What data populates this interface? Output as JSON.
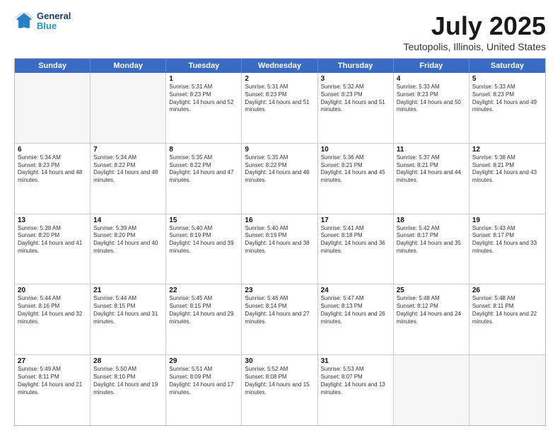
{
  "header": {
    "logo_line1": "General",
    "logo_line2": "Blue",
    "title": "July 2025",
    "subtitle": "Teutopolis, Illinois, United States"
  },
  "weekdays": [
    "Sunday",
    "Monday",
    "Tuesday",
    "Wednesday",
    "Thursday",
    "Friday",
    "Saturday"
  ],
  "weeks": [
    [
      {
        "day": "",
        "sunrise": "",
        "sunset": "",
        "daylight": "",
        "empty": true
      },
      {
        "day": "",
        "sunrise": "",
        "sunset": "",
        "daylight": "",
        "empty": true
      },
      {
        "day": "1",
        "sunrise": "Sunrise: 5:31 AM",
        "sunset": "Sunset: 8:23 PM",
        "daylight": "Daylight: 14 hours and 52 minutes."
      },
      {
        "day": "2",
        "sunrise": "Sunrise: 5:31 AM",
        "sunset": "Sunset: 8:23 PM",
        "daylight": "Daylight: 14 hours and 51 minutes."
      },
      {
        "day": "3",
        "sunrise": "Sunrise: 5:32 AM",
        "sunset": "Sunset: 8:23 PM",
        "daylight": "Daylight: 14 hours and 51 minutes."
      },
      {
        "day": "4",
        "sunrise": "Sunrise: 5:33 AM",
        "sunset": "Sunset: 8:23 PM",
        "daylight": "Daylight: 14 hours and 50 minutes."
      },
      {
        "day": "5",
        "sunrise": "Sunrise: 5:33 AM",
        "sunset": "Sunset: 8:23 PM",
        "daylight": "Daylight: 14 hours and 49 minutes."
      }
    ],
    [
      {
        "day": "6",
        "sunrise": "Sunrise: 5:34 AM",
        "sunset": "Sunset: 8:23 PM",
        "daylight": "Daylight: 14 hours and 48 minutes."
      },
      {
        "day": "7",
        "sunrise": "Sunrise: 5:34 AM",
        "sunset": "Sunset: 8:22 PM",
        "daylight": "Daylight: 14 hours and 48 minutes."
      },
      {
        "day": "8",
        "sunrise": "Sunrise: 5:35 AM",
        "sunset": "Sunset: 8:22 PM",
        "daylight": "Daylight: 14 hours and 47 minutes."
      },
      {
        "day": "9",
        "sunrise": "Sunrise: 5:35 AM",
        "sunset": "Sunset: 8:22 PM",
        "daylight": "Daylight: 14 hours and 46 minutes."
      },
      {
        "day": "10",
        "sunrise": "Sunrise: 5:36 AM",
        "sunset": "Sunset: 8:21 PM",
        "daylight": "Daylight: 14 hours and 45 minutes."
      },
      {
        "day": "11",
        "sunrise": "Sunrise: 5:37 AM",
        "sunset": "Sunset: 8:21 PM",
        "daylight": "Daylight: 14 hours and 44 minutes."
      },
      {
        "day": "12",
        "sunrise": "Sunrise: 5:38 AM",
        "sunset": "Sunset: 8:21 PM",
        "daylight": "Daylight: 14 hours and 43 minutes."
      }
    ],
    [
      {
        "day": "13",
        "sunrise": "Sunrise: 5:38 AM",
        "sunset": "Sunset: 8:20 PM",
        "daylight": "Daylight: 14 hours and 41 minutes."
      },
      {
        "day": "14",
        "sunrise": "Sunrise: 5:39 AM",
        "sunset": "Sunset: 8:20 PM",
        "daylight": "Daylight: 14 hours and 40 minutes."
      },
      {
        "day": "15",
        "sunrise": "Sunrise: 5:40 AM",
        "sunset": "Sunset: 8:19 PM",
        "daylight": "Daylight: 14 hours and 39 minutes."
      },
      {
        "day": "16",
        "sunrise": "Sunrise: 5:40 AM",
        "sunset": "Sunset: 8:19 PM",
        "daylight": "Daylight: 14 hours and 38 minutes."
      },
      {
        "day": "17",
        "sunrise": "Sunrise: 5:41 AM",
        "sunset": "Sunset: 8:18 PM",
        "daylight": "Daylight: 14 hours and 36 minutes."
      },
      {
        "day": "18",
        "sunrise": "Sunrise: 5:42 AM",
        "sunset": "Sunset: 8:17 PM",
        "daylight": "Daylight: 14 hours and 35 minutes."
      },
      {
        "day": "19",
        "sunrise": "Sunrise: 5:43 AM",
        "sunset": "Sunset: 8:17 PM",
        "daylight": "Daylight: 14 hours and 33 minutes."
      }
    ],
    [
      {
        "day": "20",
        "sunrise": "Sunrise: 5:44 AM",
        "sunset": "Sunset: 8:16 PM",
        "daylight": "Daylight: 14 hours and 32 minutes."
      },
      {
        "day": "21",
        "sunrise": "Sunrise: 5:44 AM",
        "sunset": "Sunset: 8:15 PM",
        "daylight": "Daylight: 14 hours and 31 minutes."
      },
      {
        "day": "22",
        "sunrise": "Sunrise: 5:45 AM",
        "sunset": "Sunset: 8:15 PM",
        "daylight": "Daylight: 14 hours and 29 minutes."
      },
      {
        "day": "23",
        "sunrise": "Sunrise: 5:46 AM",
        "sunset": "Sunset: 8:14 PM",
        "daylight": "Daylight: 14 hours and 27 minutes."
      },
      {
        "day": "24",
        "sunrise": "Sunrise: 5:47 AM",
        "sunset": "Sunset: 8:13 PM",
        "daylight": "Daylight: 14 hours and 26 minutes."
      },
      {
        "day": "25",
        "sunrise": "Sunrise: 5:48 AM",
        "sunset": "Sunset: 8:12 PM",
        "daylight": "Daylight: 14 hours and 24 minutes."
      },
      {
        "day": "26",
        "sunrise": "Sunrise: 5:48 AM",
        "sunset": "Sunset: 8:11 PM",
        "daylight": "Daylight: 14 hours and 22 minutes."
      }
    ],
    [
      {
        "day": "27",
        "sunrise": "Sunrise: 5:49 AM",
        "sunset": "Sunset: 8:11 PM",
        "daylight": "Daylight: 14 hours and 21 minutes."
      },
      {
        "day": "28",
        "sunrise": "Sunrise: 5:50 AM",
        "sunset": "Sunset: 8:10 PM",
        "daylight": "Daylight: 14 hours and 19 minutes."
      },
      {
        "day": "29",
        "sunrise": "Sunrise: 5:51 AM",
        "sunset": "Sunset: 8:09 PM",
        "daylight": "Daylight: 14 hours and 17 minutes."
      },
      {
        "day": "30",
        "sunrise": "Sunrise: 5:52 AM",
        "sunset": "Sunset: 8:08 PM",
        "daylight": "Daylight: 14 hours and 15 minutes."
      },
      {
        "day": "31",
        "sunrise": "Sunrise: 5:53 AM",
        "sunset": "Sunset: 8:07 PM",
        "daylight": "Daylight: 14 hours and 13 minutes."
      },
      {
        "day": "",
        "sunrise": "",
        "sunset": "",
        "daylight": "",
        "empty": true
      },
      {
        "day": "",
        "sunrise": "",
        "sunset": "",
        "daylight": "",
        "empty": true
      }
    ]
  ]
}
